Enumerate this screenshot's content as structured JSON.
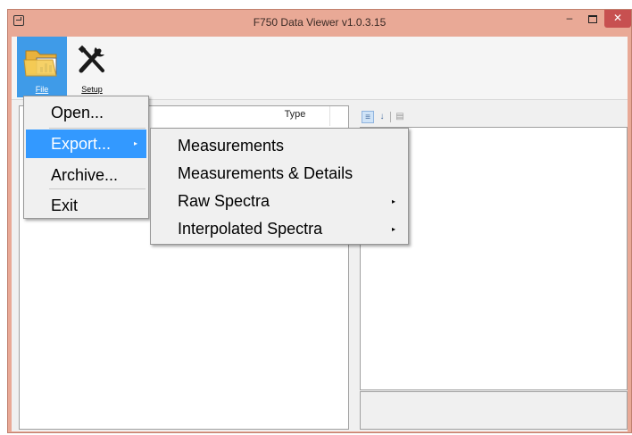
{
  "window": {
    "title": "F750 Data Viewer v1.0.3.15",
    "minimize": "–",
    "close": "✕"
  },
  "ribbon": {
    "file": {
      "label": "File",
      "icon": "folder-chart-icon"
    },
    "setup": {
      "label": "Setup",
      "icon": "tools-icon"
    }
  },
  "table": {
    "columns": [
      "Type"
    ]
  },
  "file_menu": {
    "items": [
      {
        "label": "Open..."
      },
      {
        "label": "Export...",
        "highlighted": true
      },
      {
        "label": "Archive..."
      },
      {
        "label": "Exit"
      }
    ]
  },
  "export_submenu": {
    "items": [
      {
        "label": "Measurements"
      },
      {
        "label": "Measurements & Details"
      },
      {
        "label": "Raw Spectra"
      },
      {
        "label": "Interpolated Spectra"
      }
    ]
  },
  "colors": {
    "title_bar": "#e9a996",
    "highlight": "#3399ff",
    "close_button": "#c75050"
  }
}
